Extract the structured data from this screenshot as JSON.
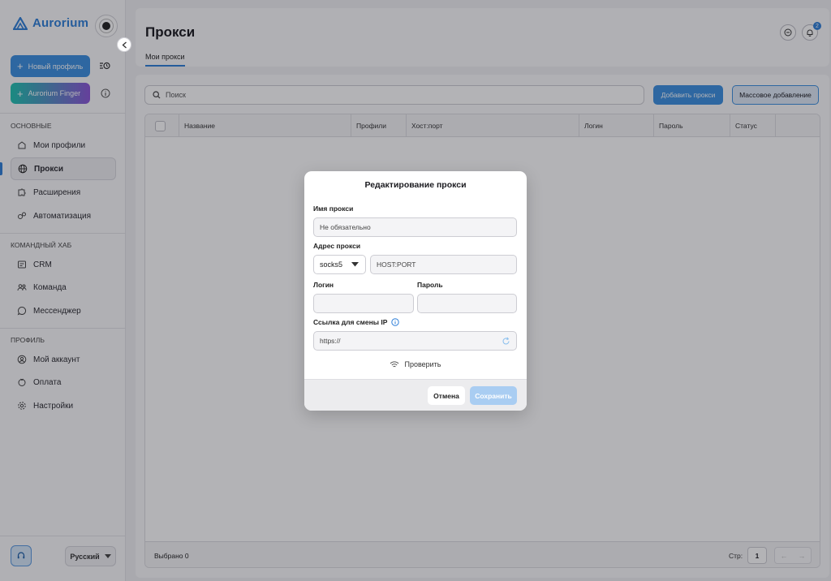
{
  "app": {
    "name": "Aurorium"
  },
  "sidebar": {
    "new_profile": "Новый профиль",
    "finger": "Aurorium Finger",
    "sections": [
      {
        "title": "ОСНОВНЫЕ",
        "items": [
          {
            "label": "Мои профили",
            "icon": "profile-icon"
          },
          {
            "label": "Прокси",
            "icon": "globe-icon",
            "active": true
          },
          {
            "label": "Расширения",
            "icon": "puzzle-icon"
          },
          {
            "label": "Автоматизация",
            "icon": "automation-icon"
          }
        ]
      },
      {
        "title": "КОМАНДНЫЙ ХАБ",
        "items": [
          {
            "label": "CRM",
            "icon": "crm-icon"
          },
          {
            "label": "Команда",
            "icon": "team-icon"
          },
          {
            "label": "Мессенджер",
            "icon": "chat-icon"
          }
        ]
      },
      {
        "title": "ПРОФИЛЬ",
        "items": [
          {
            "label": "Мой аккаунт",
            "icon": "user-icon"
          },
          {
            "label": "Оплата",
            "icon": "payment-icon"
          },
          {
            "label": "Настройки",
            "icon": "gear-icon"
          }
        ]
      }
    ],
    "language": "Русский"
  },
  "header": {
    "title": "Прокси",
    "tab": "Мои прокси",
    "notifications": "2"
  },
  "toolbar": {
    "search_placeholder": "Поиск",
    "add_proxy": "Добавить прокси",
    "bulk_add": "Массовое добавление"
  },
  "table": {
    "columns": [
      "Название",
      "Профили",
      "Хост:порт",
      "Логин",
      "Пароль",
      "Статус"
    ],
    "selected": "Выбрано 0",
    "page_label": "Стр:",
    "page": "1",
    "prev": "←",
    "next": "→"
  },
  "modal": {
    "title": "Редактирование прокси",
    "name_label": "Имя прокси",
    "name_placeholder": "Не обязательно",
    "address_label": "Адрес прокси",
    "protocol": "socks5",
    "host_placeholder": "HOST:PORT",
    "login_label": "Логин",
    "password_label": "Пароль",
    "ip_link_label": "Ссылка для смены IP",
    "ip_link_placeholder": "https://",
    "check": "Проверить",
    "cancel": "Отмена",
    "save": "Сохранить"
  },
  "colors": {
    "accent": "#3b8fe0",
    "accent_light": "#a9cdf2"
  }
}
